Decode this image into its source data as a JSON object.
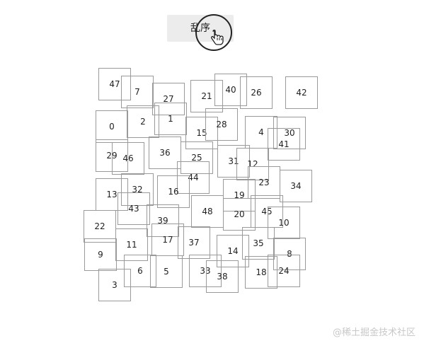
{
  "toolbar": {
    "shuffle_label": "乱序"
  },
  "tiles": [
    "47",
    "7",
    "27",
    "21",
    "40",
    "26",
    "42",
    "0",
    "2",
    "1",
    "15",
    "28",
    "4",
    "30",
    "41",
    "29",
    "46",
    "36",
    "25",
    "31",
    "12",
    "44",
    "13",
    "32",
    "16",
    "23",
    "34",
    "19",
    "43",
    "22",
    "48",
    "20",
    "45",
    "39",
    "10",
    "17",
    "37",
    "11",
    "14",
    "35",
    "8",
    "9",
    "6",
    "5",
    "33",
    "38",
    "18",
    "24",
    "3"
  ],
  "watermark": "@稀土掘金技术社区",
  "colors": {
    "button_bg": "#ececec",
    "tile_border": "#9a9a9a",
    "pointer_ring": "#222222"
  }
}
